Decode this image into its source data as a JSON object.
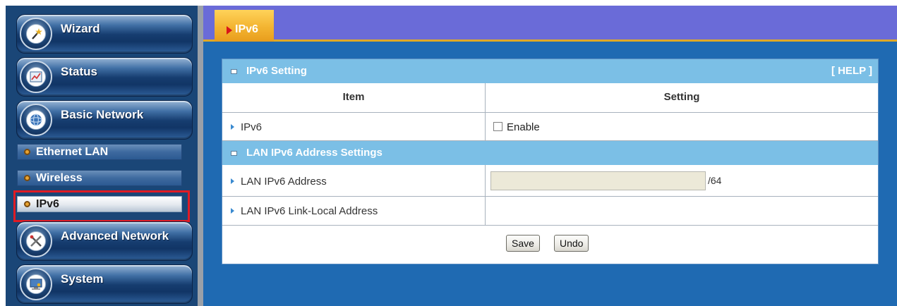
{
  "sidebar": {
    "main_items": [
      {
        "label": "Wizard",
        "icon": "wizard-wand-icon"
      },
      {
        "label": "Status",
        "icon": "status-chart-icon"
      },
      {
        "label": "Basic Network",
        "icon": "globe-icon"
      },
      {
        "label": "Advanced Network",
        "icon": "tools-icon"
      },
      {
        "label": "System",
        "icon": "computer-icon"
      }
    ],
    "sub_items": [
      {
        "label": "Ethernet LAN",
        "active": false
      },
      {
        "label": "Wireless",
        "active": false
      },
      {
        "label": "IPv6",
        "active": true
      }
    ]
  },
  "tab": {
    "label": "IPv6"
  },
  "panel": {
    "section1": {
      "title": "IPv6 Setting",
      "help": "[ HELP ]"
    },
    "columns": {
      "item": "Item",
      "setting": "Setting"
    },
    "ipv6_row": {
      "label": "IPv6",
      "checkbox_label": "Enable",
      "checked": false
    },
    "section2": {
      "title": "LAN IPv6 Address Settings"
    },
    "lan_addr_row": {
      "label": "LAN IPv6 Address",
      "value": "",
      "suffix": "/64"
    },
    "link_local_row": {
      "label": "LAN IPv6 Link-Local Address",
      "value": ""
    },
    "buttons": {
      "save": "Save",
      "undo": "Undo"
    }
  },
  "colors": {
    "sidebar_bg": "#1a4677",
    "tabbar_bg": "#6a6bd8",
    "tab_active": "#f3b431",
    "section_head": "#7bbfe6",
    "main_bg": "#1f6ab2",
    "highlight": "#e01b24"
  }
}
